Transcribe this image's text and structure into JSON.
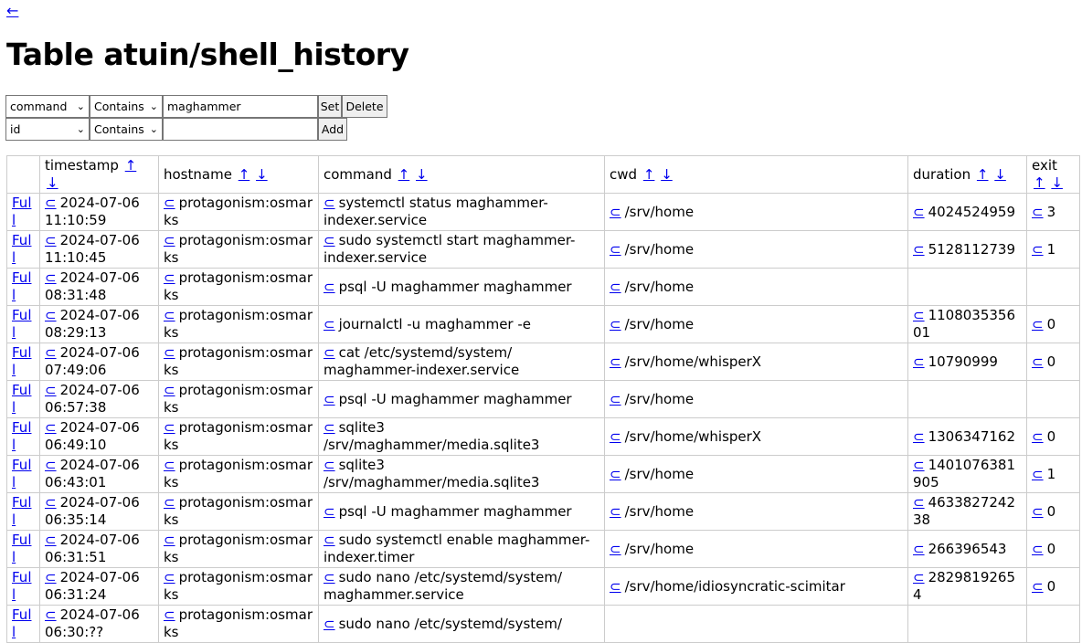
{
  "back_link": "←",
  "title": "Table atuin/shell_history",
  "filters": [
    {
      "column": "command",
      "operator": "Contains",
      "value": "maghammer",
      "buttons": [
        "Set",
        "Delete"
      ]
    },
    {
      "column": "id",
      "operator": "Contains",
      "value": "",
      "buttons": [
        "Add"
      ]
    }
  ],
  "sort_asc": "↑",
  "sort_desc": "↓",
  "filter_icon": "⊂",
  "full_label": "Full",
  "columns": [
    "timestamp",
    "hostname",
    "command",
    "cwd",
    "duration",
    "exit"
  ],
  "rows": [
    {
      "timestamp": "2024-07-06 11:10:59",
      "hostname": "protagonism:osmarks",
      "command": "systemctl status maghammer-indexer.service",
      "cwd": "/srv/home",
      "duration": "4024524959",
      "exit": "3"
    },
    {
      "timestamp": "2024-07-06 11:10:45",
      "hostname": "protagonism:osmarks",
      "command": "sudo systemctl start maghammer-indexer.service",
      "cwd": "/srv/home",
      "duration": "5128112739",
      "exit": "1"
    },
    {
      "timestamp": "2024-07-06 08:31:48",
      "hostname": "protagonism:osmarks",
      "command": "psql -U maghammer maghammer",
      "cwd": "/srv/home",
      "duration": "",
      "exit": ""
    },
    {
      "timestamp": "2024-07-06 08:29:13",
      "hostname": "protagonism:osmarks",
      "command": "journalctl -u maghammer -e",
      "cwd": "/srv/home",
      "duration": "110803535601",
      "exit": "0"
    },
    {
      "timestamp": "2024-07-06 07:49:06",
      "hostname": "protagonism:osmarks",
      "command": "cat /etc/systemd/system/ maghammer-indexer.service",
      "cwd": "/srv/home/whisperX",
      "duration": "10790999",
      "exit": "0"
    },
    {
      "timestamp": "2024-07-06 06:57:38",
      "hostname": "protagonism:osmarks",
      "command": "psql -U maghammer maghammer",
      "cwd": "/srv/home",
      "duration": "",
      "exit": ""
    },
    {
      "timestamp": "2024-07-06 06:49:10",
      "hostname": "protagonism:osmarks",
      "command": "sqlite3 /srv/maghammer/media.sqlite3",
      "cwd": "/srv/home/whisperX",
      "duration": "1306347162",
      "exit": "0"
    },
    {
      "timestamp": "2024-07-06 06:43:01",
      "hostname": "protagonism:osmarks",
      "command": "sqlite3 /srv/maghammer/media.sqlite3",
      "cwd": "/srv/home",
      "duration": "1401076381905",
      "exit": "1"
    },
    {
      "timestamp": "2024-07-06 06:35:14",
      "hostname": "protagonism:osmarks",
      "command": "psql -U maghammer maghammer",
      "cwd": "/srv/home",
      "duration": "463382724238",
      "exit": "0"
    },
    {
      "timestamp": "2024-07-06 06:31:51",
      "hostname": "protagonism:osmarks",
      "command": "sudo systemctl enable maghammer-indexer.timer",
      "cwd": "/srv/home",
      "duration": "266396543",
      "exit": "0"
    },
    {
      "timestamp": "2024-07-06 06:31:24",
      "hostname": "protagonism:osmarks",
      "command": "sudo nano /etc/systemd/system/ maghammer.service",
      "cwd": "/srv/home/idiosyncratic-scimitar",
      "duration": "28298192654",
      "exit": "0"
    },
    {
      "timestamp": "2024-07-06 06:30:??",
      "hostname": "protagonism:osmarks",
      "command": "sudo nano /etc/systemd/system/",
      "cwd": "",
      "duration": "",
      "exit": ""
    }
  ]
}
